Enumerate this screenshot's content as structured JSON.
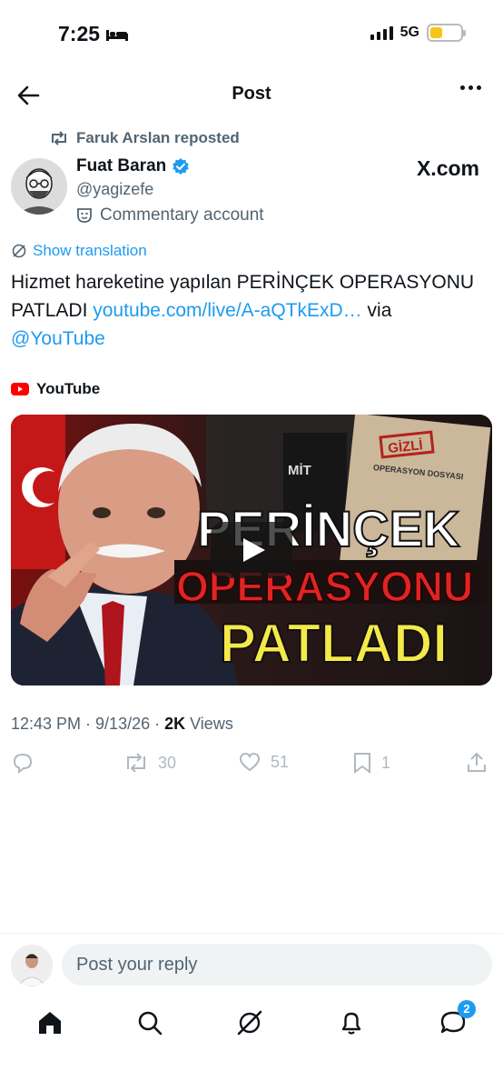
{
  "status_bar": {
    "time": "7:25",
    "network": "5G",
    "battery_level": 0.4
  },
  "header": {
    "title": "Post"
  },
  "repost": {
    "text": "Faruk Arslan reposted"
  },
  "author": {
    "name": "Fuat Baran",
    "handle": "@yagizefe",
    "verified": true,
    "label": "Commentary account"
  },
  "brand": "X.com",
  "translation": {
    "label": "Show translation"
  },
  "tweet": {
    "text_plain": "Hizmet hareketine yapılan PERİNÇEK OPERASYONU PATLADI ",
    "link": "youtube.com/live/A-aQTkExD…",
    "via": " via ",
    "mention": "@YouTube"
  },
  "card": {
    "source": "YouTube",
    "thumbnail_text": {
      "line1": "PERİNÇEK",
      "line2": "OPERASYONU",
      "line3": "PATLADI",
      "tag": "MİT",
      "stamp": "GİZLİ",
      "doc_title": "OPERASYON DOSYASI"
    }
  },
  "meta": {
    "time": "12:43 PM",
    "sep": "·",
    "date": "9/13/26",
    "views_count": "2K",
    "views_label": "Views"
  },
  "actions": {
    "replies": "",
    "reposts": "30",
    "likes": "51",
    "bookmarks": "1"
  },
  "reply": {
    "placeholder": "Post your reply"
  },
  "nav": {
    "messages_badge": "2"
  },
  "colors": {
    "link": "#1d9bf0",
    "muted": "#536471",
    "text": "#0f1419"
  }
}
